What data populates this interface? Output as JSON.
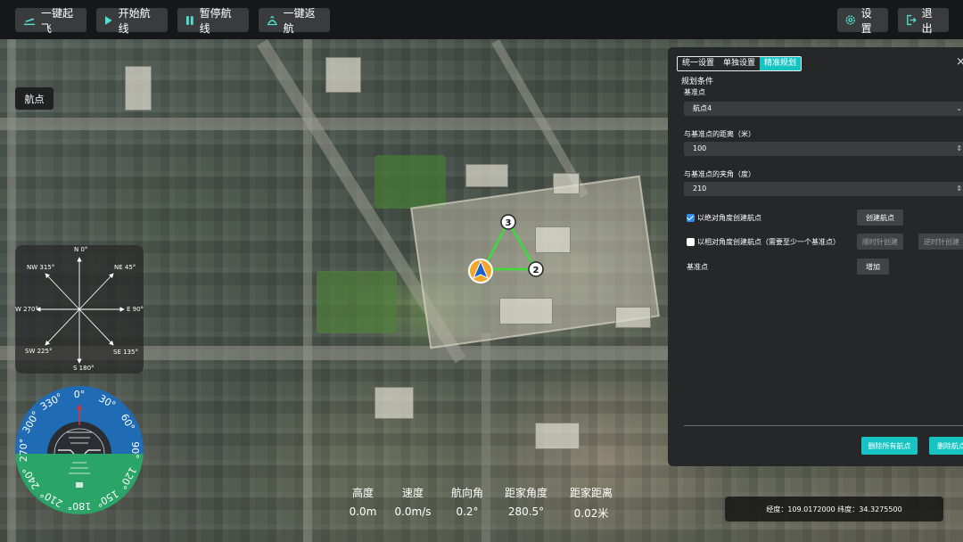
{
  "topbar": {
    "takeoff": "一键起飞",
    "start_route": "开始航线",
    "pause_route": "暂停航线",
    "return_home": "一键返航",
    "settings": "设置",
    "exit": "退出"
  },
  "map": {
    "waypoint_chip": "航点",
    "waypoints": [
      {
        "number": "3"
      },
      {
        "number": "2"
      }
    ]
  },
  "compass_rose": {
    "n": "N 0°",
    "ne": "NE 45°",
    "e": "E 90°",
    "se": "SE 135°",
    "s": "S 180°",
    "sw": "SW 225°",
    "w": "W 270°",
    "nw": "NW 315°"
  },
  "attitude": {
    "heading_ticks": [
      "0°",
      "30°",
      "60°",
      "90°",
      "120°",
      "150°",
      "180°",
      "210°",
      "240°",
      "270°",
      "300°",
      "330°"
    ],
    "sky_color": "#1f6cb4",
    "ground_color": "#2aa567"
  },
  "telemetry": {
    "altitude": {
      "label": "高度",
      "value": "0.0m"
    },
    "speed": {
      "label": "速度",
      "value": "0.0m/s"
    },
    "heading": {
      "label": "航向角",
      "value": "0.2°"
    },
    "home_angle": {
      "label": "距家角度",
      "value": "280.5°"
    },
    "home_distance": {
      "label": "距家距离",
      "value": "0.02米"
    }
  },
  "coords": {
    "text": "经度：109.0172000 纬度：34.3275500"
  },
  "panel": {
    "tabs": [
      "统一设置",
      "单独设置",
      "精准规划"
    ],
    "active_tab": "精准规划",
    "close": "×",
    "section_title": "规划条件",
    "base_point_label": "基准点",
    "base_point_value": "航点4",
    "distance_label": "与基准点的距离（米）",
    "distance_value": "100",
    "angle_label": "与基准点的夹角（度）",
    "angle_value": "210",
    "absolute_checkbox": {
      "label": "以绝对角度创建航点",
      "checked": true
    },
    "create_waypoint": "创建航点",
    "relative_checkbox": {
      "label": "以相对角度创建航点（需要至少一个基准点）",
      "checked": false
    },
    "create_clockwise": "顺时针创建",
    "create_counterclockwise": "逆时针创建",
    "base_points_label": "基准点",
    "add": "增加",
    "delete_all": "删除所有航点",
    "delete_waypoint": "删除航点"
  },
  "colors": {
    "accent": "#17c4c4",
    "route": "#3bdc3b",
    "checkbox": "#2b8ef0"
  }
}
